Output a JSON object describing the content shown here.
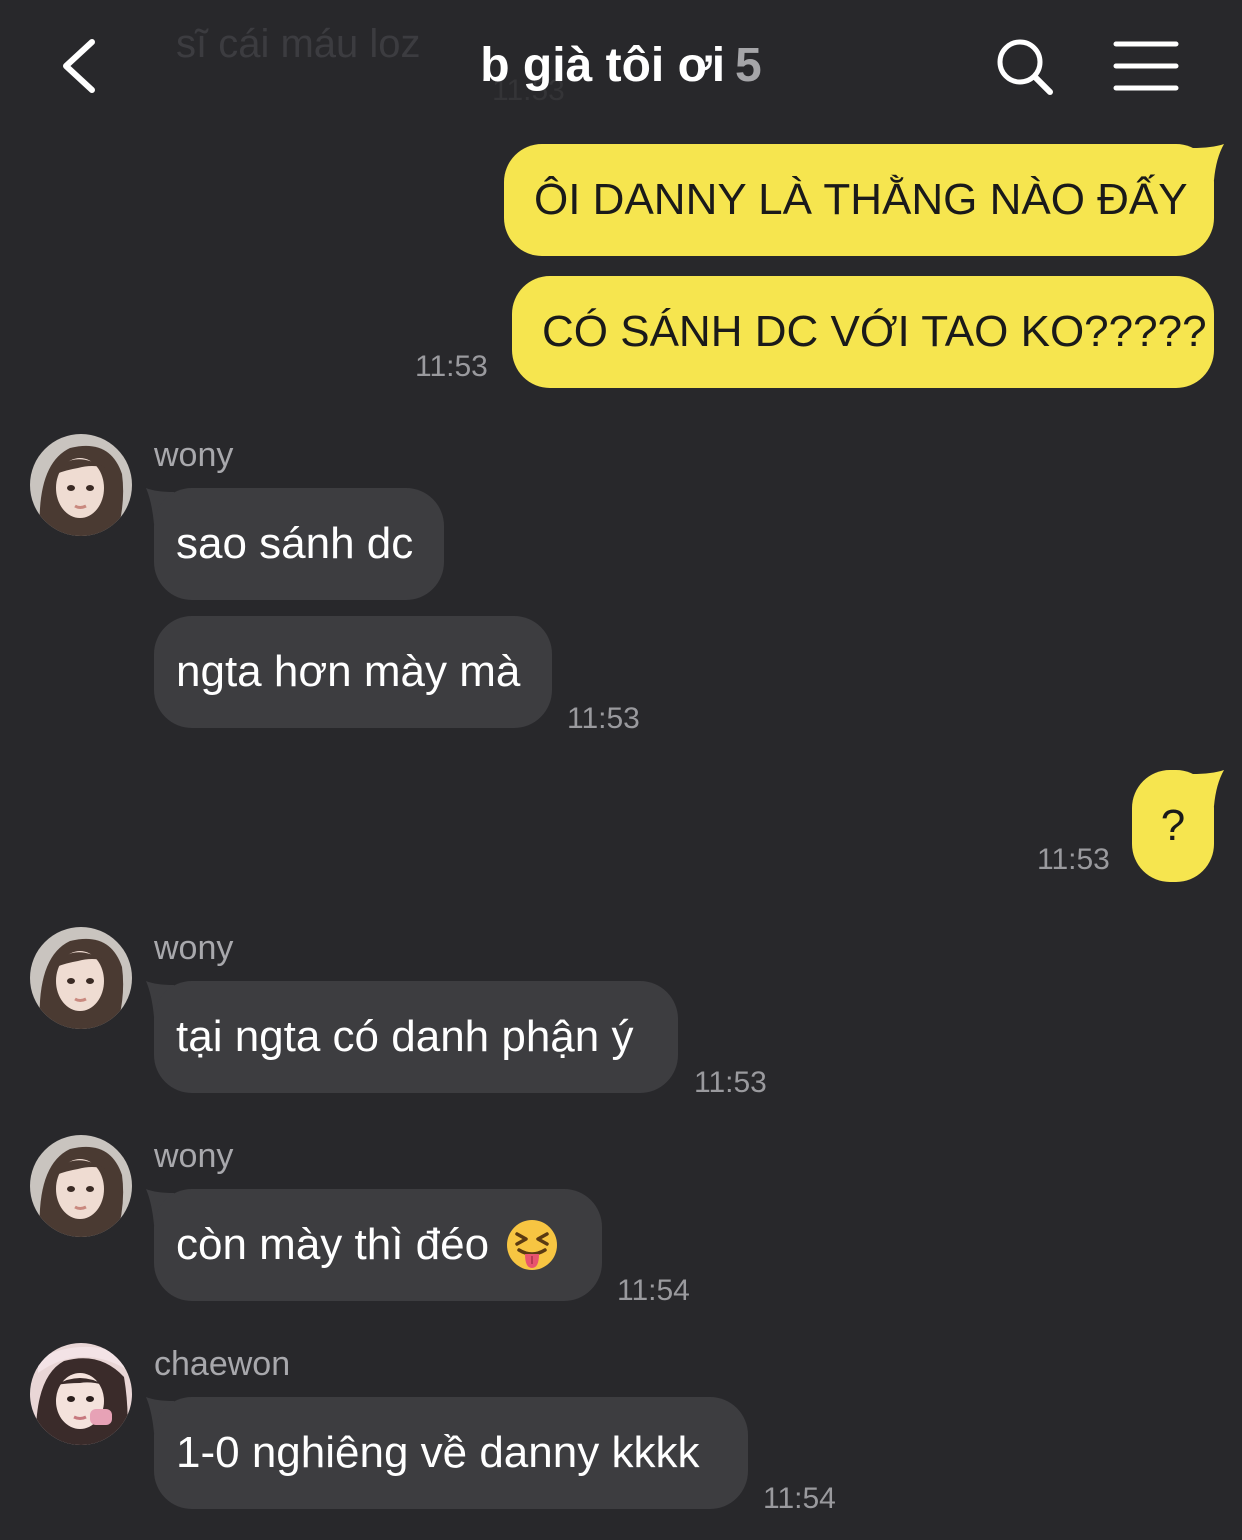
{
  "preview": {
    "text": "sĩ cái máu loz",
    "sub": "11:53"
  },
  "header": {
    "title": "b già tôi ơi",
    "count": "5"
  },
  "messages": [
    {
      "text": "ÔI DANNY LÀ THẰNG NÀO ĐẤY"
    },
    {
      "text": "CÓ SÁNH DC VỚI TAO KO?????",
      "time": "11:53"
    },
    {
      "sender": "wony",
      "text": "sao sánh dc"
    },
    {
      "text": "ngta hơn mày mà",
      "time": "11:53"
    },
    {
      "text": "?",
      "time": "11:53"
    },
    {
      "sender": "wony",
      "text": "tại ngta có danh phận ý",
      "time": "11:53"
    },
    {
      "sender": "wony",
      "text": "còn mày thì đéo",
      "emoji": "squinting-tongue-emoji",
      "time": "11:54"
    },
    {
      "sender": "chaewon",
      "text": "1-0 nghiêng về danny kkkk",
      "time": "11:54"
    }
  ],
  "colors": {
    "background": "#28282b",
    "my_bubble": "#f6e54f",
    "their_bubble": "#3d3d40",
    "time_text": "#9a9a9e"
  }
}
